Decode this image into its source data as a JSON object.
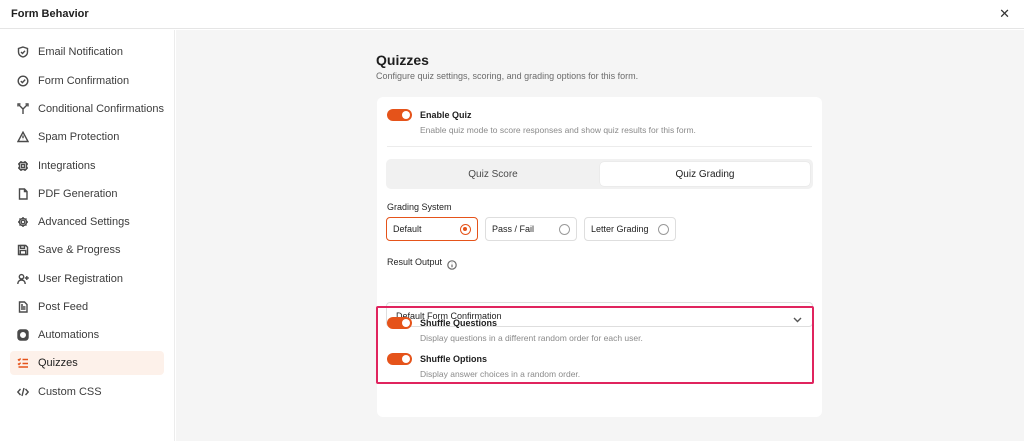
{
  "window": {
    "title": "Form Behavior",
    "close_glyph": "✕"
  },
  "sidebar": {
    "items": [
      {
        "label": "Email Notification",
        "icon": "shield-icon"
      },
      {
        "label": "Form Confirmation",
        "icon": "check-circle-icon"
      },
      {
        "label": "Conditional Confirmations",
        "icon": "branch-icon"
      },
      {
        "label": "Spam Protection",
        "icon": "warning-icon"
      },
      {
        "label": "Integrations",
        "icon": "chip-icon"
      },
      {
        "label": "PDF Generation",
        "icon": "file-icon"
      },
      {
        "label": "Advanced Settings",
        "icon": "gear-icon"
      },
      {
        "label": "Save & Progress",
        "icon": "save-icon"
      },
      {
        "label": "User Registration",
        "icon": "user-plus-icon"
      },
      {
        "label": "Post Feed",
        "icon": "document-icon"
      },
      {
        "label": "Automations",
        "icon": "automation-icon"
      },
      {
        "label": "Quizzes",
        "icon": "list-check-icon",
        "active": true
      },
      {
        "label": "Custom CSS",
        "icon": "code-icon"
      }
    ]
  },
  "main": {
    "title": "Quizzes",
    "subtitle": "Configure quiz settings, scoring, and grading options for this form.",
    "enable_quiz": {
      "label": "Enable Quiz",
      "description": "Enable quiz mode to score responses and show quiz results for this form.",
      "on": true
    },
    "tabs": [
      {
        "label": "Quiz Score",
        "active": false
      },
      {
        "label": "Quiz Grading",
        "active": true
      }
    ],
    "grading_system": {
      "label": "Grading System",
      "options": [
        {
          "label": "Default",
          "selected": true
        },
        {
          "label": "Pass / Fail",
          "selected": false
        },
        {
          "label": "Letter Grading",
          "selected": false
        }
      ]
    },
    "result_output": {
      "label": "Result Output",
      "value": "Default Form Confirmation"
    },
    "shuffle_questions": {
      "label": "Shuffle Questions",
      "description": "Display questions in a different random order for each user.",
      "on": true
    },
    "shuffle_options": {
      "label": "Shuffle Options",
      "description": "Display answer choices in a random order.",
      "on": true
    }
  },
  "colors": {
    "accent": "#e5531a",
    "highlight_border": "#e0245e",
    "active_nav_bg": "#fdf1ea"
  }
}
